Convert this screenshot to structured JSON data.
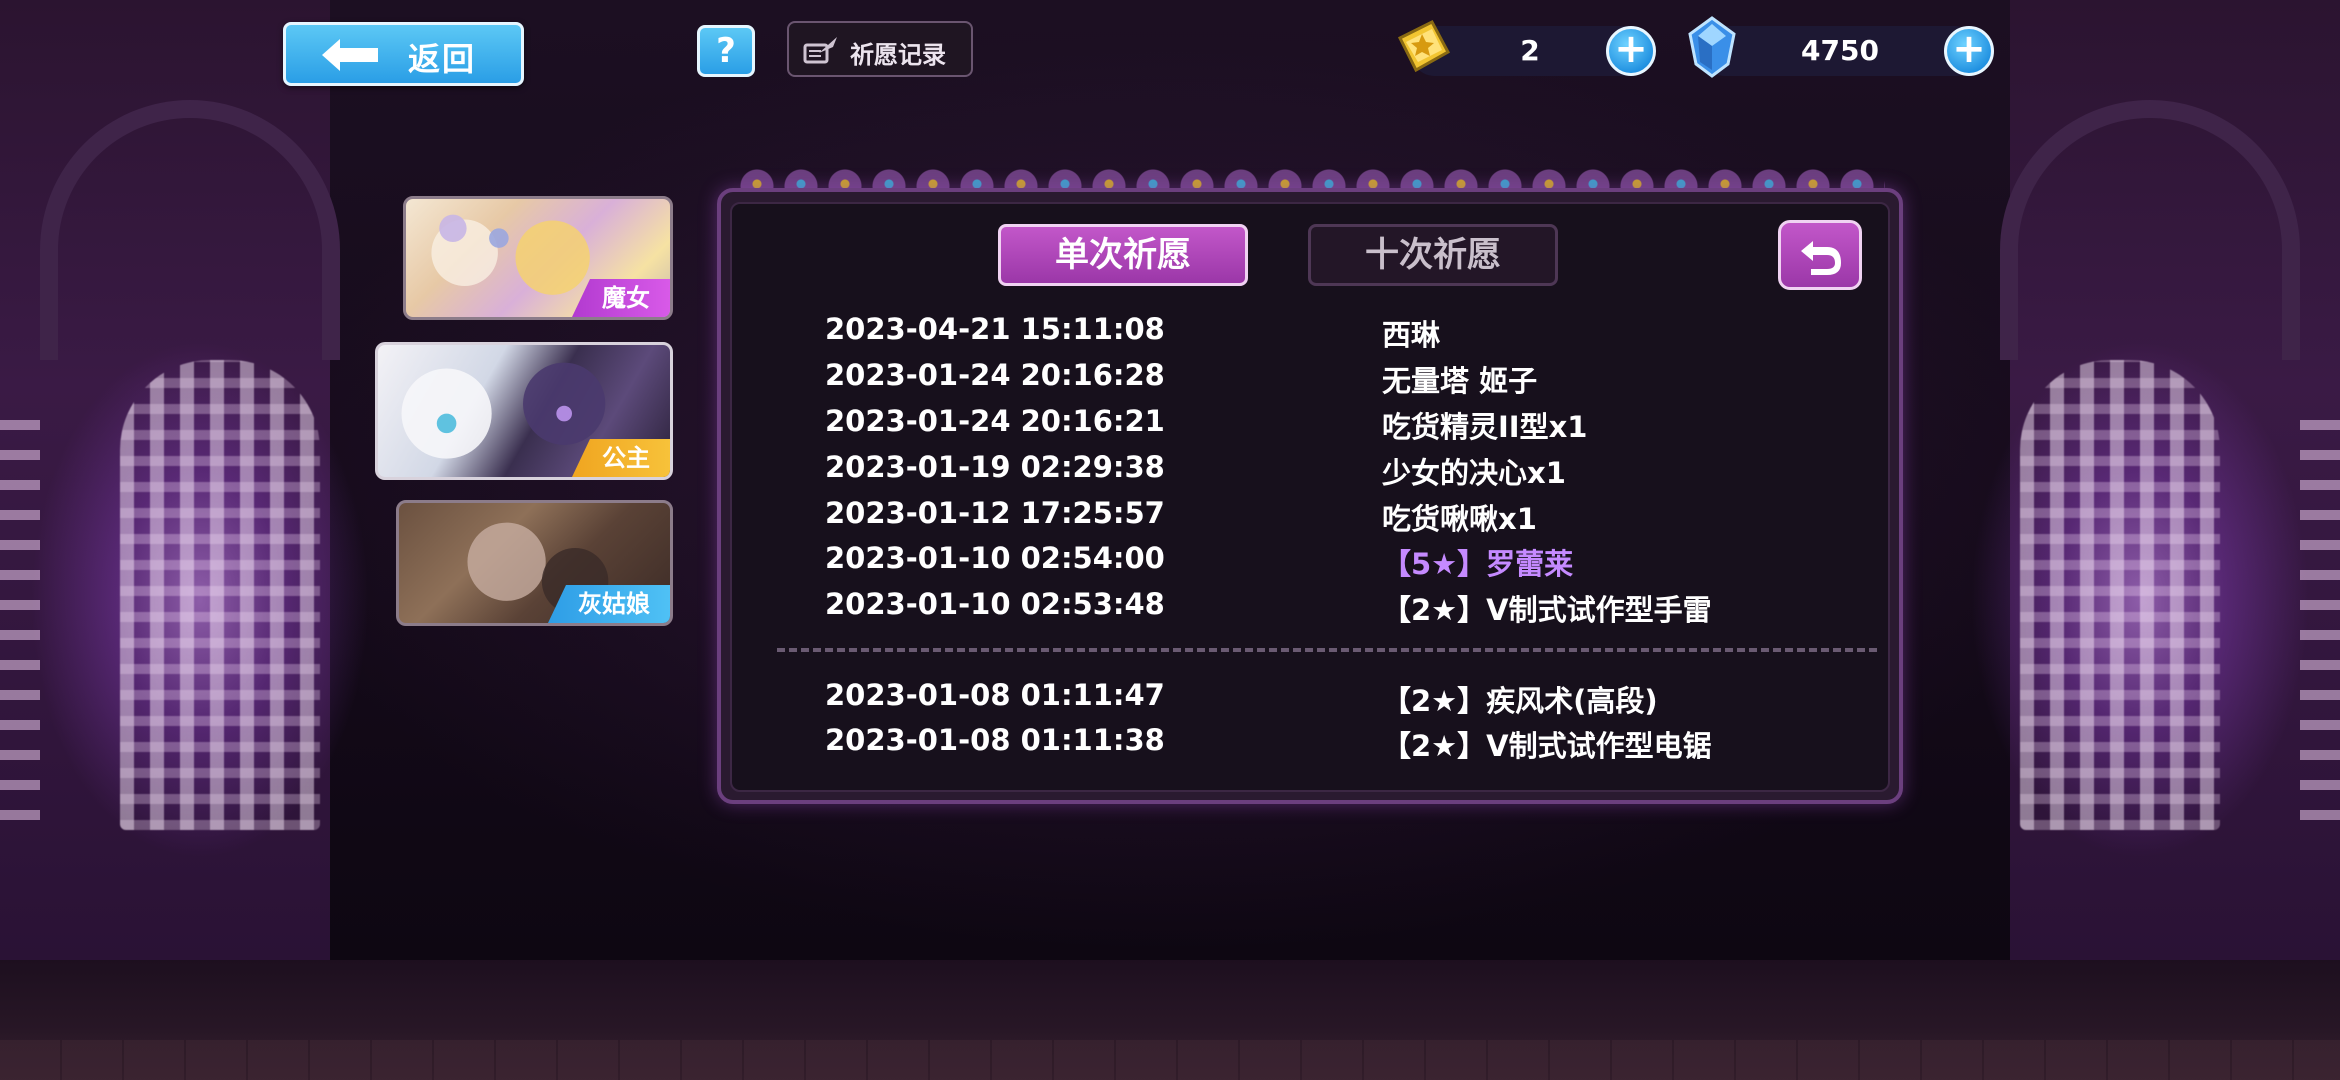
{
  "header": {
    "back_label": "返回",
    "help_label": "?",
    "record_label": "祈愿记录"
  },
  "currency": {
    "gold": {
      "icon": "gold-ticket-icon",
      "value": "2"
    },
    "gem": {
      "icon": "crystal-icon",
      "value": "4750"
    }
  },
  "banners": [
    {
      "tag": "魔女"
    },
    {
      "tag": "公主"
    },
    {
      "tag": "灰姑娘"
    }
  ],
  "tabs": {
    "single": "单次祈愿",
    "ten": "十次祈愿"
  },
  "records_top": [
    {
      "time": "2023-04-21 15:11:08",
      "item": "西琳"
    },
    {
      "time": "2023-01-24 20:16:28",
      "item": "无量塔 姬子"
    },
    {
      "time": "2023-01-24 20:16:21",
      "item": "吃货精灵II型x1"
    },
    {
      "time": "2023-01-19 02:29:38",
      "item": "少女的决心x1"
    },
    {
      "time": "2023-01-12 17:25:57",
      "item": "吃货啾啾x1"
    },
    {
      "time": "2023-01-10 02:54:00",
      "item": "【5★】罗蕾莱"
    },
    {
      "time": "2023-01-10 02:53:48",
      "item": "【2★】V制式试作型手雷"
    }
  ],
  "records_bottom": [
    {
      "time": "2023-01-08 01:11:47",
      "item": "【2★】疾风术(高段)"
    },
    {
      "time": "2023-01-08 01:11:38",
      "item": "【2★】V制式试作型电锯"
    }
  ],
  "colors": {
    "accent": "#b043c0",
    "rare": "#c58aff",
    "button_blue": "#2a9ee6"
  }
}
